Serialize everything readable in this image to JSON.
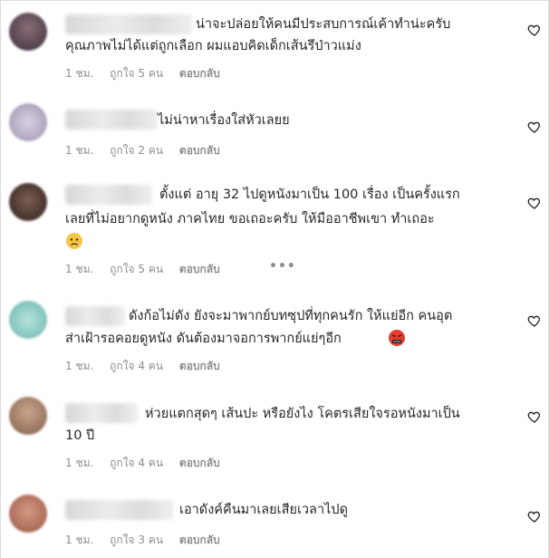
{
  "comments": [
    {
      "line1": "น่าจะปล่อยให้คนมีประสบการณ์เค้าทำน่ะครับ",
      "line2": "คุณภาพไม่ได้แต่ถูกเลือก ผมแอบคิดเด็กเส้นรึป่าวแม่ง",
      "time": "1 ชม.",
      "likes": "ถูกใจ 5 คน",
      "reply": "ตอบกลับ"
    },
    {
      "line1": "ไม่น่าหาเรื่องใส่หัวเลยย",
      "time": "1 ชม.",
      "likes": "ถูกใจ 2 คน",
      "reply": "ตอบกลับ"
    },
    {
      "line1": "ตั้งแต่ อายุ 32 ไปดูหนังมาเป็น 100 เรื่อง เป็นครั้งแรก",
      "line2": "เลยที่ไม่อยากดูหนัง ภาคไทย ขอเถอะครับ ให้มืออาชีพเขา ทำเถอะ",
      "time": "1 ชม.",
      "likes": "ถูกใจ 5 คน",
      "reply": "ตอบกลับ",
      "more": "•••"
    },
    {
      "line1": "ดังก้อไม่ดัง ยังจะมาพากย์บทซุปที่ทุกคนรัก ให้แย่อีก คนอุต",
      "line2": "ส่าเฝ้ารอคอยดูหนัง ดันต้องมาจอการพากย์แย่ๆอีก",
      "time": "1 ชม.",
      "likes": "ถูกใจ 4 คน",
      "reply": "ตอบกลับ"
    },
    {
      "line1": "ห่วยแตกสุดๆ เส้นปะ หรือยังไง โคตรเสียใจรอหนังมาเป็น",
      "line2": "10 ปี",
      "time": "1 ชม.",
      "likes": "ถูกใจ 4 คน",
      "reply": "ตอบกลับ"
    },
    {
      "line1": "เอาดังค์คืนมาเลยเสียเวลาไปดู",
      "time": "1 ชม.",
      "likes": "ถูกใจ 3 คน",
      "reply": "ตอบกลับ"
    }
  ],
  "icons": {
    "like": "heart-outline-icon",
    "more": "more-options-icon",
    "sad": "sad-face-emoji-icon",
    "angry": "cursing-face-emoji-icon"
  },
  "colors": {
    "text": "#262626",
    "meta": "#8e8e8e"
  }
}
